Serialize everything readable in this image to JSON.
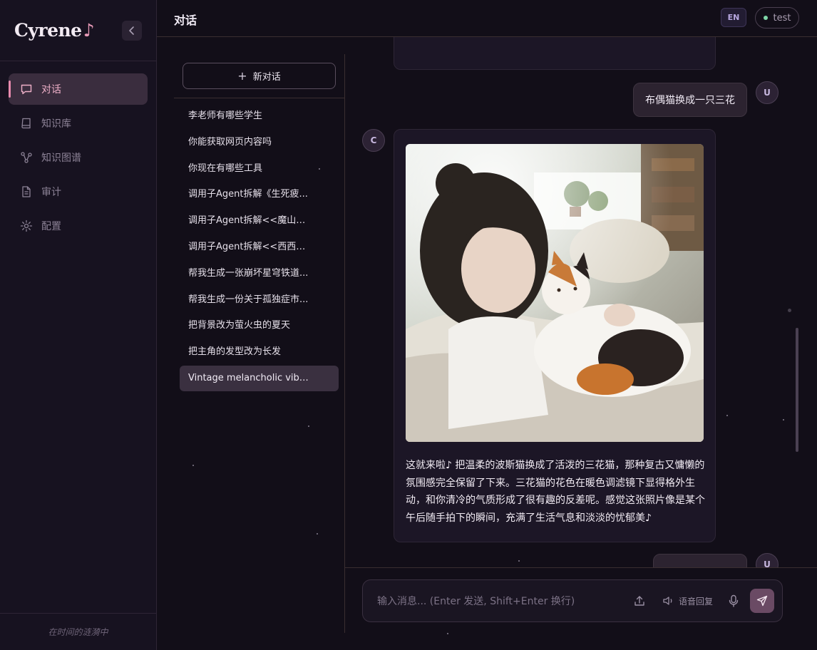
{
  "app": {
    "brand": "Cyrene",
    "brand_note": "♪",
    "collapse_icon": "chevron-left-icon",
    "footer_text": "在时间的涟漪中"
  },
  "nav": {
    "items": [
      {
        "label": "对话",
        "icon": "chat-icon",
        "active": true
      },
      {
        "label": "知识库",
        "icon": "book-icon",
        "active": false
      },
      {
        "label": "知识图谱",
        "icon": "graph-icon",
        "active": false
      },
      {
        "label": "审计",
        "icon": "document-icon",
        "active": false
      },
      {
        "label": "配置",
        "icon": "gear-icon",
        "active": false
      }
    ]
  },
  "topbar": {
    "title": "对话",
    "lang_label": "EN",
    "user_name": "test"
  },
  "conversations": {
    "new_label": "新对话",
    "items": [
      "李老师有哪些学生",
      "你能获取网页内容吗",
      "你现在有哪些工具",
      "调用子Agent拆解《生死疲...",
      "调用子Agent拆解<<魔山>>",
      "调用子Agent拆解<<西西弗...",
      "帮我生成一张崩坏星穹铁道...",
      "帮我生成一份关于孤独症市...",
      "把背景改为萤火虫的夏天",
      "把主角的发型改为长发",
      "Vintage melancholic vibe,..."
    ],
    "active_index": 10
  },
  "chat": {
    "user_avatar": "U",
    "assistant_avatar": "C",
    "user_message": "布偶猫换成一只三花",
    "assistant_image_alt": "woman-with-calico-cat-photo",
    "assistant_text": "这就来啦♪ 把温柔的波斯猫换成了活泼的三花猫，那种复古又慵懒的氛围感完全保留了下来。三花猫的花色在暖色调滤镜下显得格外生动，和你清冷的气质形成了很有趣的反差呢。感觉这张照片像是某个午后随手拍下的瞬间，充满了生活气息和淡淡的忧郁美♪"
  },
  "input": {
    "placeholder": "输入消息... (Enter 发送, Shift+Enter 换行)",
    "voice_reply_label": "语音回复"
  },
  "colors": {
    "accent": "#e88aae",
    "background": "#120e18",
    "sidebar": "#171220",
    "send_button": "#6a4a64"
  }
}
